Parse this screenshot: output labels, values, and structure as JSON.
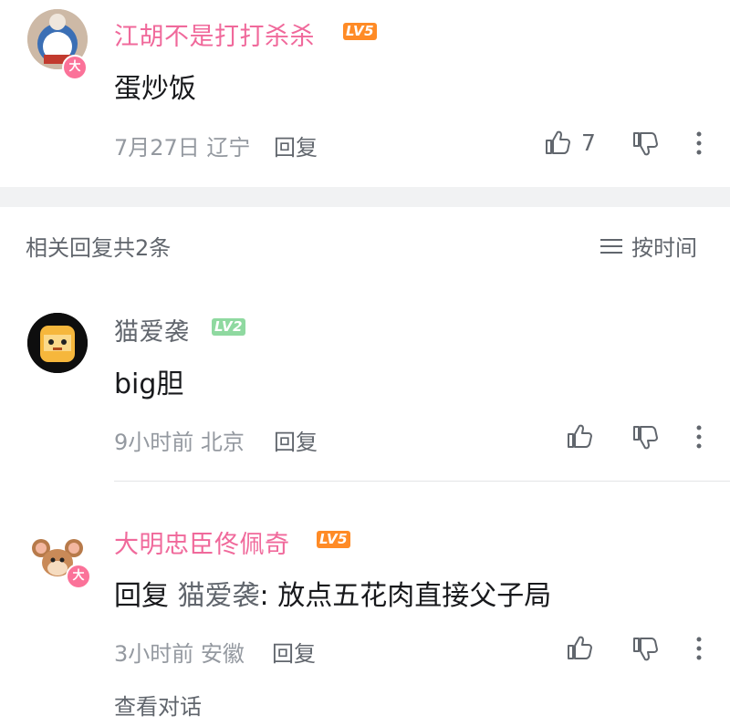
{
  "main_comment": {
    "username": "江胡不是打打杀杀",
    "level": "LV5",
    "vip_badge": "大",
    "content": "蛋炒饭",
    "date_location": "7月27日 辽宁",
    "reply_label": "回复",
    "like_count": "7",
    "icons": [
      "thumbs-up-icon",
      "thumbs-down-icon",
      "more-icon"
    ]
  },
  "replies_header": {
    "title": "相关回复共2条",
    "sort_label": "按时间",
    "sort_icon": "list-icon"
  },
  "replies": [
    {
      "username": "猫爱袭",
      "level": "LV2",
      "content": "big胆",
      "date_location": "9小时前 北京",
      "reply_label": "回复"
    },
    {
      "username": "大明忠臣佟佩奇",
      "level": "LV5",
      "vip_badge": "大",
      "content_prefix": "回复 ",
      "mention": "猫爱袭",
      "content_suffix": ": 放点五花肉直接父子局",
      "date_location": "3小时前 安徽",
      "reply_label": "回复",
      "view_conversation": "查看对话"
    }
  ],
  "colors": {
    "vip_name": "#f0699b",
    "normal_name": "#61666d",
    "lv5": "#ff8b26",
    "lv2": "#8fd9a0",
    "divider": "#f1f2f3"
  }
}
